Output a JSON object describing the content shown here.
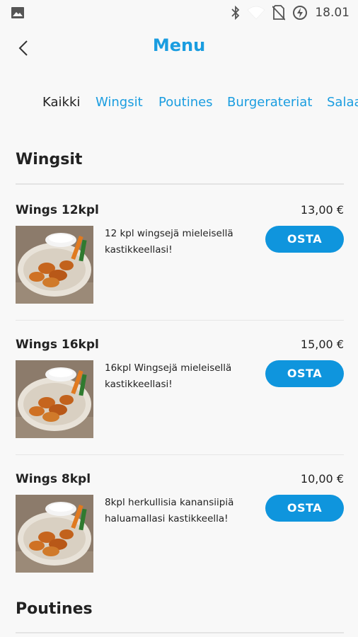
{
  "status_bar": {
    "time": "18.01",
    "icons": [
      "image-icon",
      "bluetooth-icon",
      "wifi-icon",
      "no-sim-icon",
      "battery-saver-icon"
    ]
  },
  "header": {
    "title": "Menu",
    "back_icon": "chevron-left-icon"
  },
  "tabs": [
    {
      "label": "Kaikki",
      "active": true
    },
    {
      "label": "Wingsit",
      "active": false
    },
    {
      "label": "Poutines",
      "active": false
    },
    {
      "label": "Burgerateriat",
      "active": false
    },
    {
      "label": "Salaa",
      "active": false
    }
  ],
  "sections": [
    {
      "title": "Wingsit",
      "items": [
        {
          "name": "Wings 12kpl",
          "price": "13,00 €",
          "description": "12 kpl wingsejä mieleisellä kastikkeellasi!",
          "button": "OSTA"
        },
        {
          "name": "Wings 16kpl",
          "price": "15,00 €",
          "description": "16kpl Wingsejä mieleisellä kastikkeellasi!",
          "button": "OSTA"
        },
        {
          "name": "Wings 8kpl",
          "price": "10,00 €",
          "description": "8kpl herkullisia kanansiipiä haluamallasi kastikkeella!",
          "button": "OSTA"
        }
      ]
    },
    {
      "title": "Poutines",
      "items": []
    }
  ],
  "colors": {
    "accent": "#1a9de0",
    "button": "#0f95dd",
    "background": "#f8f8f8"
  }
}
